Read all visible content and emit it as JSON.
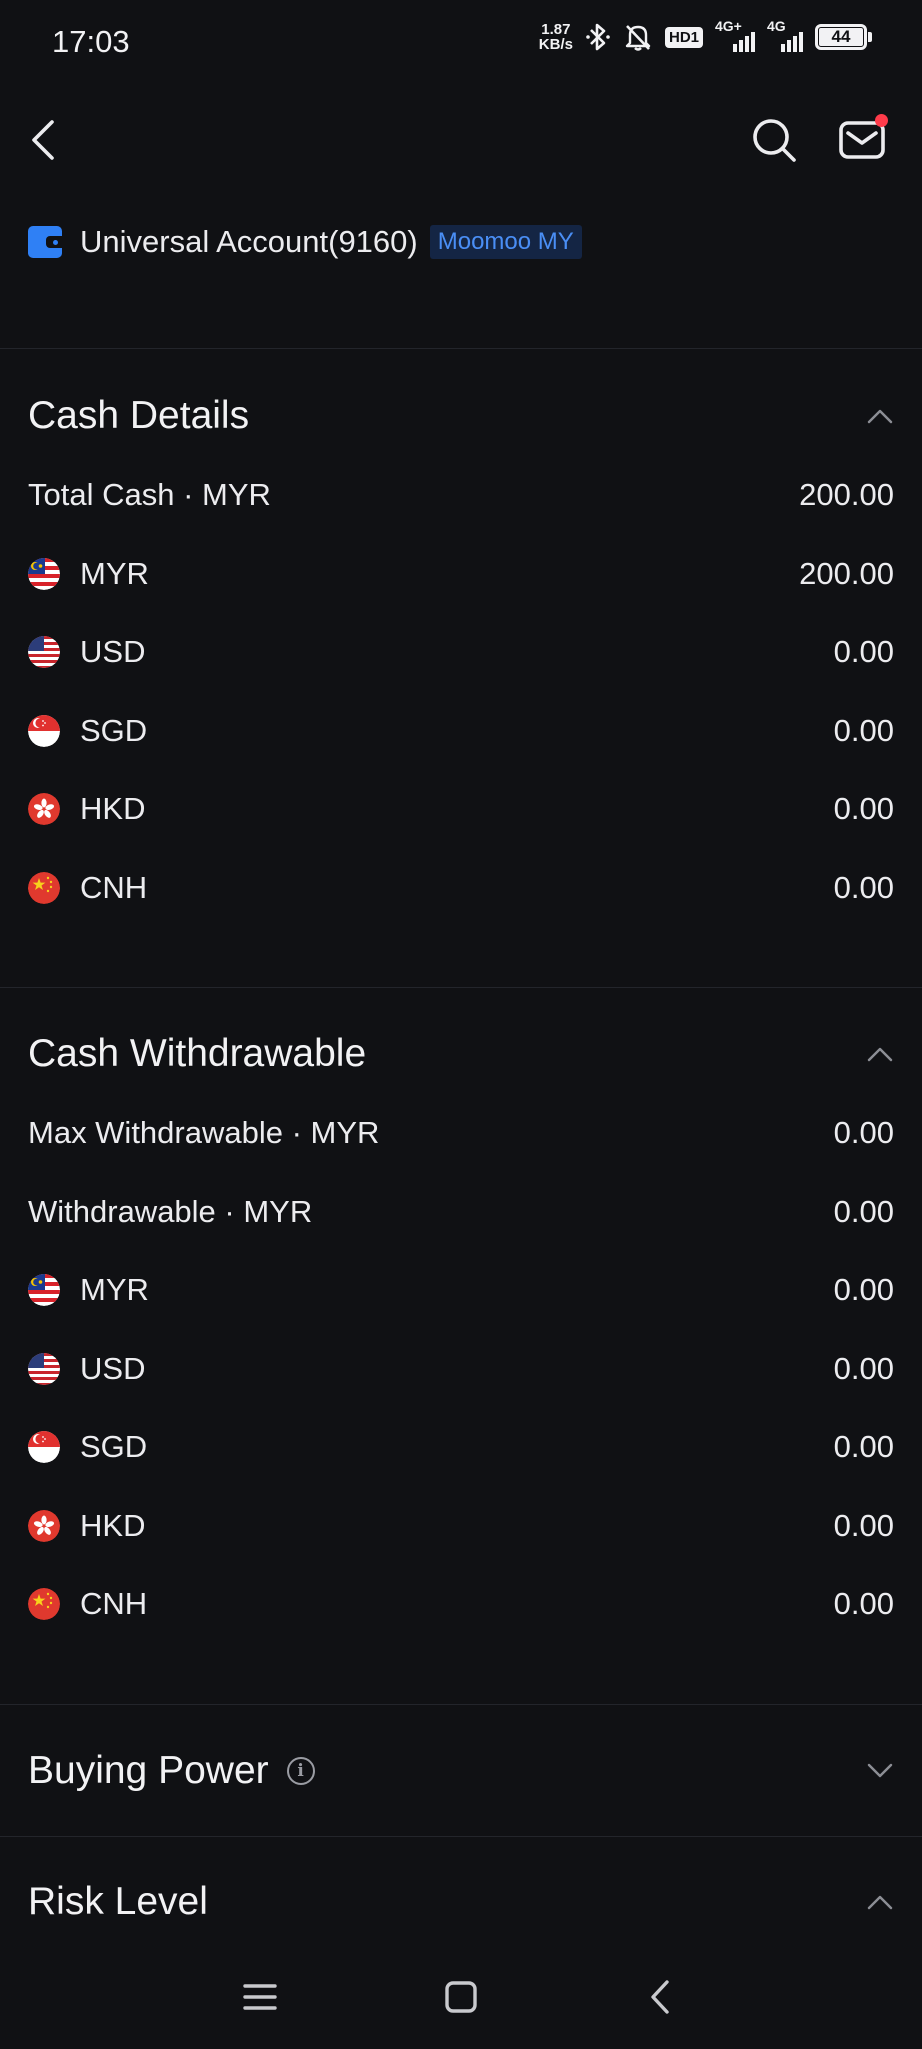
{
  "status_bar": {
    "time": "17:03",
    "net_speed_value": "1.87",
    "net_speed_unit": "KB/s",
    "hd_label": "HD1",
    "sim1_label": "4G+",
    "sim2_label": "4G",
    "battery_level": "44"
  },
  "account": {
    "name": "Universal Account(9160)",
    "broker": "Moomoo MY"
  },
  "cash_details": {
    "title": "Cash Details",
    "total_label": "Total Cash · MYR",
    "total_value": "200.00",
    "currencies": [
      {
        "code": "MYR",
        "value": "200.00"
      },
      {
        "code": "USD",
        "value": "0.00"
      },
      {
        "code": "SGD",
        "value": "0.00"
      },
      {
        "code": "HKD",
        "value": "0.00"
      },
      {
        "code": "CNH",
        "value": "0.00"
      }
    ]
  },
  "cash_withdrawable": {
    "title": "Cash Withdrawable",
    "max_label": "Max Withdrawable · MYR",
    "max_value": "0.00",
    "withdrawable_label": "Withdrawable · MYR",
    "withdrawable_value": "0.00",
    "currencies": [
      {
        "code": "MYR",
        "value": "0.00"
      },
      {
        "code": "USD",
        "value": "0.00"
      },
      {
        "code": "SGD",
        "value": "0.00"
      },
      {
        "code": "HKD",
        "value": "0.00"
      },
      {
        "code": "CNH",
        "value": "0.00"
      }
    ]
  },
  "buying_power": {
    "title": "Buying Power",
    "info_glyph": "i"
  },
  "risk_level": {
    "title": "Risk Level"
  },
  "icons": {
    "back": "back-arrow-icon",
    "search": "search-icon",
    "mail": "mail-icon",
    "expand": "chevron-down-icon",
    "collapse": "chevron-up-icon"
  },
  "colors": {
    "background": "#101114",
    "accent": "#2f80f5",
    "notification": "#ff3b4a",
    "badge_bg": "#142544"
  }
}
